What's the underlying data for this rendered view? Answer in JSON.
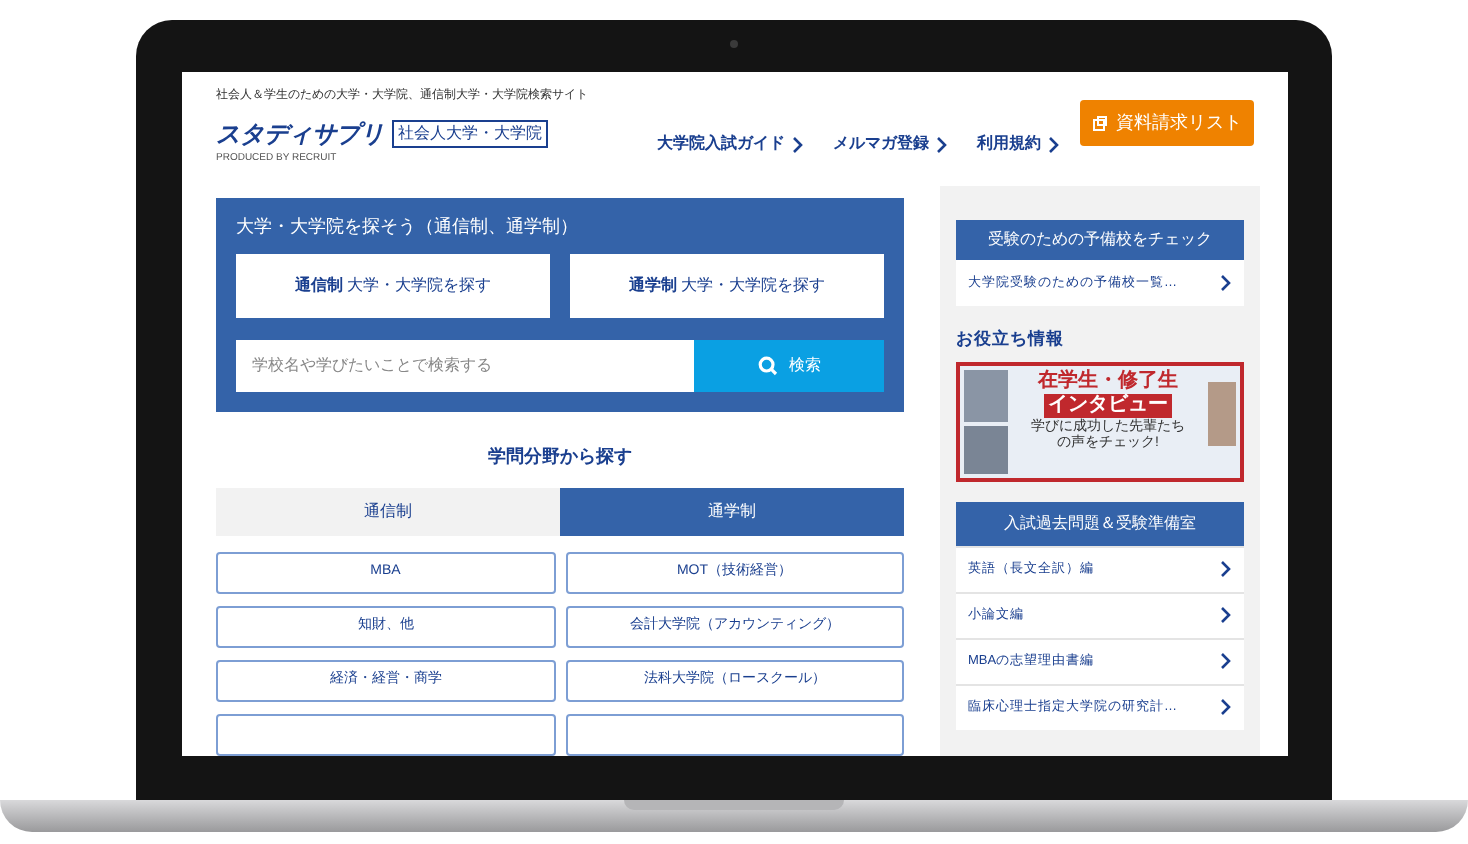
{
  "header": {
    "tagline": "社会人＆学生のための大学・大学院、通信制大学・大学院検索サイト",
    "logo": "スタディサプリ",
    "logo_sub": "社会人大学・大学院",
    "logo_credit": "PRODUCED BY RECRUIT",
    "nav": [
      {
        "label": "大学院入試ガイド"
      },
      {
        "label": "メルマガ登録"
      },
      {
        "label": "利用規約"
      }
    ],
    "cta_button": "資料請求リスト"
  },
  "search_panel": {
    "title": "大学・大学院を探そう（通信制、通学制）",
    "buttons": [
      {
        "strong": "通信制",
        "label": "大学・大学院を探す"
      },
      {
        "strong": "通学制",
        "label": "大学・大学院を探す"
      }
    ],
    "search": {
      "placeholder": "学校名や学びたいことで検索する",
      "button": "検索"
    }
  },
  "fields_heading": "学問分野から探す",
  "tabs": [
    {
      "label": "通信制",
      "selected": false
    },
    {
      "label": "通学制",
      "selected": true
    }
  ],
  "fields": [
    "MBA",
    "MOT（技術経営）",
    "知財、他",
    "会計大学院（アカウンティング）",
    "経済・経営・商学",
    "法科大学院（ロースクール）"
  ],
  "sidebar": {
    "prep": {
      "title": "受験のための予備校をチェック",
      "link": "大学院受験のための予備校一覧…"
    },
    "info_heading": "お役立ち情報",
    "banner": {
      "title_1": "在学生・修了生",
      "title_2": "インタビュー",
      "subtitle": "学びに成功した先輩たちの声をチェック!"
    },
    "exam": {
      "title": "入試過去問題＆受験準備室",
      "links": [
        "英語（長文全訳）編",
        "小論文編",
        "MBAの志望理由書編",
        "臨床心理士指定大学院の研究計…"
      ]
    }
  }
}
